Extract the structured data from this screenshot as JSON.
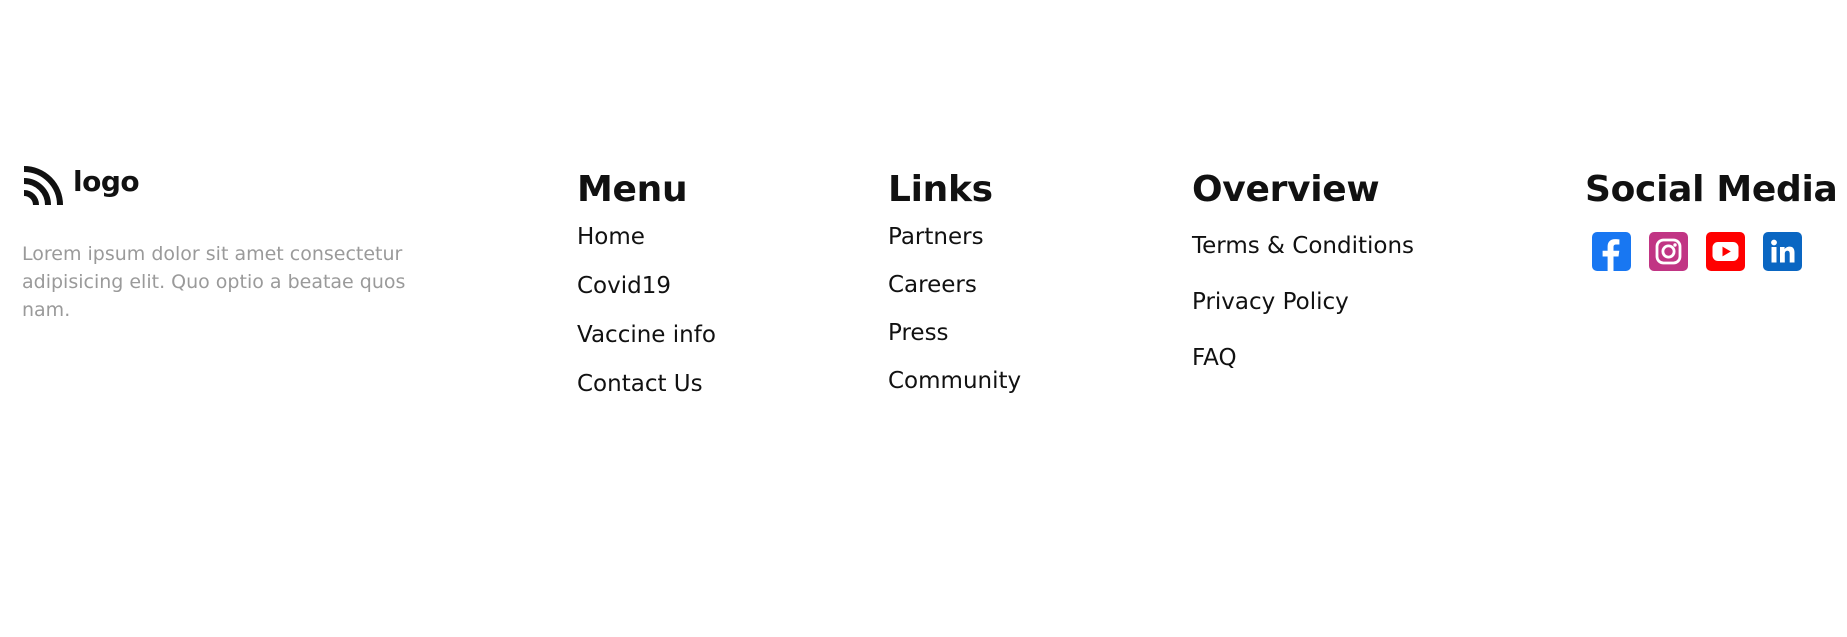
{
  "brand": {
    "name": "logo",
    "description": "Lorem ipsum dolor sit amet consectetur adipisicing elit. Quo optio a beatae quos nam."
  },
  "columns": {
    "menu": {
      "title": "Menu",
      "items": [
        "Home",
        "Covid19",
        "Vaccine info",
        "Contact Us"
      ]
    },
    "links": {
      "title": "Links",
      "items": [
        "Partners",
        "Careers",
        "Press",
        "Community"
      ]
    },
    "overview": {
      "title": "Overview",
      "items": [
        "Terms & Conditions",
        "Privacy Policy",
        "FAQ"
      ]
    },
    "social": {
      "title": "Social Media",
      "icons": [
        {
          "name": "facebook-icon",
          "color": "#1877f2"
        },
        {
          "name": "instagram-icon",
          "color": "#c13584"
        },
        {
          "name": "youtube-icon",
          "color": "#ff0000"
        },
        {
          "name": "linkedin-icon",
          "color": "#0a66c2"
        }
      ]
    }
  },
  "colors": {
    "text": "#111111",
    "muted": "#9a9a9a",
    "background": "#ffffff"
  }
}
